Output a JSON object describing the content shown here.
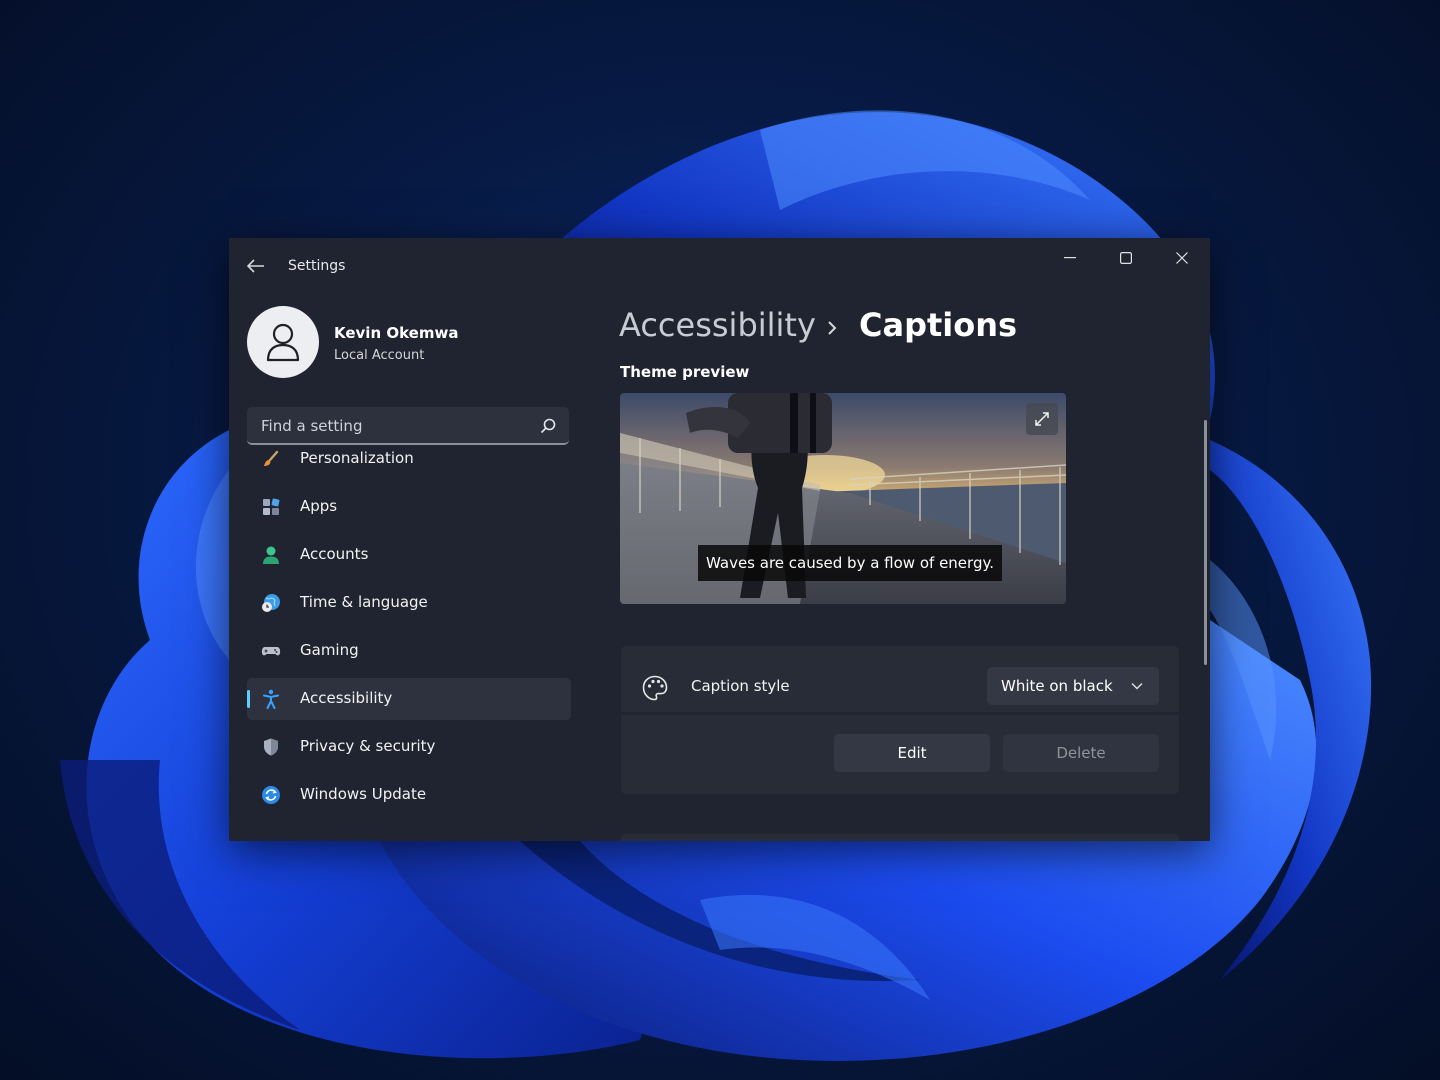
{
  "window": {
    "title": "Settings",
    "accent": "#60cdff",
    "background": "#1f2430"
  },
  "profile": {
    "name": "Kevin Okemwa",
    "account_type": "Local Account"
  },
  "search": {
    "placeholder": "Find a setting"
  },
  "nav": {
    "items": [
      {
        "label": "Personalization",
        "icon": "paintbrush-icon",
        "selected": false
      },
      {
        "label": "Apps",
        "icon": "apps-icon",
        "selected": false
      },
      {
        "label": "Accounts",
        "icon": "person-icon",
        "selected": false
      },
      {
        "label": "Time & language",
        "icon": "globe-clock-icon",
        "selected": false
      },
      {
        "label": "Gaming",
        "icon": "gamepad-icon",
        "selected": false
      },
      {
        "label": "Accessibility",
        "icon": "accessibility-icon",
        "selected": true
      },
      {
        "label": "Privacy & security",
        "icon": "shield-icon",
        "selected": false
      },
      {
        "label": "Windows Update",
        "icon": "update-icon",
        "selected": false
      }
    ]
  },
  "breadcrumb": {
    "parent": "Accessibility",
    "current": "Captions"
  },
  "theme_preview": {
    "label": "Theme preview",
    "caption_text": "Waves are caused by a flow of energy."
  },
  "caption_style": {
    "label": "Caption style",
    "selected": "White on black",
    "edit_label": "Edit",
    "delete_label": "Delete"
  }
}
